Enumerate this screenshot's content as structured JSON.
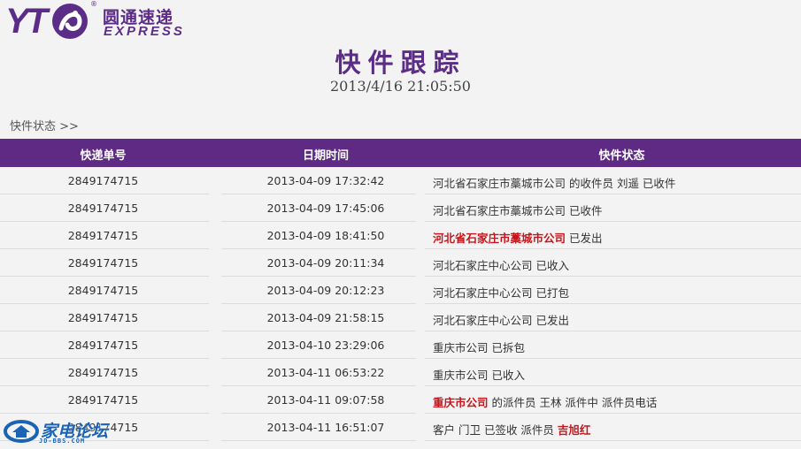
{
  "brand": {
    "logo_letters": "YT",
    "name_cn": "圆通速递",
    "name_en": "EXPRESS",
    "registered": "®",
    "color": "#5c2d86"
  },
  "page": {
    "title": "快件跟踪",
    "datetime": "2013/4/16 21:05:50",
    "section_label": "快件状态 >>"
  },
  "table": {
    "headers": [
      "快递单号",
      "日期时间",
      "快件状态"
    ],
    "header_bg": "#5e2a84",
    "rows": [
      {
        "number": "2849174715",
        "time": "2013-04-09 17:32:42",
        "status": [
          {
            "text": "河北省石家庄市藁城市公司 的收件员 刘遥 已收件",
            "highlight": false
          }
        ]
      },
      {
        "number": "2849174715",
        "time": "2013-04-09 17:45:06",
        "status": [
          {
            "text": "河北省石家庄市藁城市公司 已收件",
            "highlight": false
          }
        ]
      },
      {
        "number": "2849174715",
        "time": "2013-04-09 18:41:50",
        "status": [
          {
            "text": "河北省石家庄市藁城市公司",
            "highlight": true
          },
          {
            "text": " 已发出",
            "highlight": false
          }
        ]
      },
      {
        "number": "2849174715",
        "time": "2013-04-09 20:11:34",
        "status": [
          {
            "text": "河北石家庄中心公司 已收入",
            "highlight": false
          }
        ]
      },
      {
        "number": "2849174715",
        "time": "2013-04-09 20:12:23",
        "status": [
          {
            "text": "河北石家庄中心公司 已打包",
            "highlight": false
          }
        ]
      },
      {
        "number": "2849174715",
        "time": "2013-04-09 21:58:15",
        "status": [
          {
            "text": "河北石家庄中心公司 已发出",
            "highlight": false
          }
        ]
      },
      {
        "number": "2849174715",
        "time": "2013-04-10 23:29:06",
        "status": [
          {
            "text": "重庆市公司 已拆包",
            "highlight": false
          }
        ]
      },
      {
        "number": "2849174715",
        "time": "2013-04-11 06:53:22",
        "status": [
          {
            "text": "重庆市公司 已收入",
            "highlight": false
          }
        ]
      },
      {
        "number": "2849174715",
        "time": "2013-04-11 09:07:58",
        "status": [
          {
            "text": "重庆市公司",
            "highlight": true
          },
          {
            "text": " 的派件员 王林 派件中 派件员电话",
            "highlight": false
          }
        ]
      },
      {
        "number": "2849174715",
        "time": "2013-04-11 16:51:07",
        "status": [
          {
            "text": "客户 门卫 已签收 派件员 ",
            "highlight": false
          },
          {
            "text": "吉旭红",
            "highlight": true
          }
        ]
      }
    ]
  },
  "watermark": {
    "text": "家电论坛",
    "sub": "JD-BBS.COM"
  }
}
